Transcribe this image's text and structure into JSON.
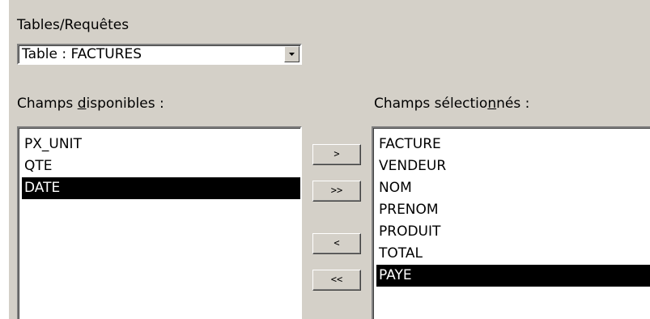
{
  "tables_label": "Tables/Requêtes",
  "combo": {
    "value": "Table : FACTURES",
    "arrow_icon": "triangle-down"
  },
  "available_label": {
    "before": "Champs ",
    "underlined": "d",
    "after": "isponibles :"
  },
  "selected_label": {
    "before": "Champs sélectio",
    "underlined": "n",
    "after": "nés :"
  },
  "available_fields": [
    {
      "label": "PX_UNIT",
      "selected": false
    },
    {
      "label": "QTE",
      "selected": false
    },
    {
      "label": "DATE",
      "selected": true
    }
  ],
  "selected_fields": [
    {
      "label": "FACTURE",
      "selected": false
    },
    {
      "label": "VENDEUR",
      "selected": false
    },
    {
      "label": "NOM",
      "selected": false
    },
    {
      "label": "PRENOM",
      "selected": false
    },
    {
      "label": "PRODUIT",
      "selected": false
    },
    {
      "label": "TOTAL",
      "selected": false
    },
    {
      "label": "PAYE",
      "selected": true
    }
  ],
  "buttons": {
    "add_one": ">",
    "add_all": ">>",
    "remove_one": "<",
    "remove_all": "<<"
  },
  "colors": {
    "dialog_bg": "#d4d0c8",
    "selection_bg": "#000000",
    "selection_fg": "#ffffff"
  }
}
